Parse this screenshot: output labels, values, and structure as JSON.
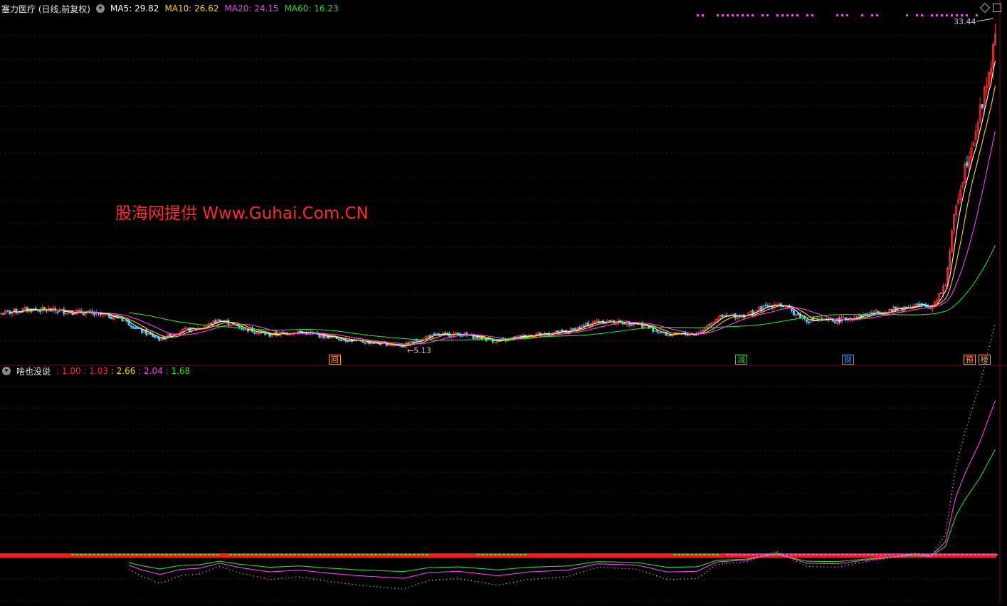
{
  "main_panel": {
    "title": "塞力医疗 (日线,前复权)",
    "ma": [
      {
        "label": "MA5:",
        "value": "29.82",
        "color": "#ffffff"
      },
      {
        "label": "MA10:",
        "value": "26.62",
        "color": "#ffd400"
      },
      {
        "label": "MA20:",
        "value": "24.15",
        "color": "#ff3cff"
      },
      {
        "label": "MA60:",
        "value": "16.23",
        "color": "#22e022"
      }
    ],
    "watermark": "股海网提供 Www.Guhai.Com.CN",
    "peak_label": "33.44",
    "low_label": "5.13",
    "markers": [
      {
        "text": "回",
        "color": "#ff9f40",
        "pos": 0.33
      },
      {
        "text": "减",
        "color": "#22dd22",
        "pos": 0.738
      },
      {
        "text": "财",
        "color": "#3aa0ff",
        "pos": 0.845
      },
      {
        "text": "预",
        "color": "#ff9f40",
        "pos": 0.967
      },
      {
        "text": "榜",
        "color": "#ff9f40",
        "pos": 0.982
      }
    ]
  },
  "sub_panel": {
    "title": "啥也没说",
    "values": [
      {
        "text": "1.00",
        "color": "#ff2a2a"
      },
      {
        "text": "1.03",
        "color": "#ff2a2a"
      },
      {
        "text": "2.66",
        "color": "#ffd400"
      },
      {
        "text": "2.04",
        "color": "#ff3cff"
      },
      {
        "text": "1.68",
        "color": "#22e022"
      }
    ]
  },
  "chart_data": {
    "type": "line",
    "title": "塞力医疗 (日线,前复权)",
    "price_range": [
      4.5,
      36
    ],
    "series": [
      {
        "name": "MA5",
        "color": "#ffffff",
        "last": 29.82
      },
      {
        "name": "MA10",
        "color": "#ffd400",
        "last": 26.62
      },
      {
        "name": "MA20",
        "color": "#ff3cff",
        "last": 24.15
      },
      {
        "name": "MA60",
        "color": "#22e022",
        "last": 16.23
      }
    ],
    "close_keypoints": [
      [
        0,
        8.2
      ],
      [
        0.03,
        8.6
      ],
      [
        0.08,
        8.3
      ],
      [
        0.12,
        7.8
      ],
      [
        0.14,
        6.6
      ],
      [
        0.16,
        5.8
      ],
      [
        0.18,
        6.6
      ],
      [
        0.2,
        6.8
      ],
      [
        0.22,
        7.6
      ],
      [
        0.24,
        6.9
      ],
      [
        0.27,
        6.2
      ],
      [
        0.3,
        6.5
      ],
      [
        0.33,
        6.0
      ],
      [
        0.36,
        5.6
      ],
      [
        0.405,
        5.2
      ],
      [
        0.43,
        6.1
      ],
      [
        0.46,
        6.3
      ],
      [
        0.5,
        5.6
      ],
      [
        0.53,
        6.2
      ],
      [
        0.57,
        6.5
      ],
      [
        0.6,
        7.5
      ],
      [
        0.64,
        7.3
      ],
      [
        0.67,
        6.2
      ],
      [
        0.7,
        6.3
      ],
      [
        0.72,
        7.8
      ],
      [
        0.75,
        8.1
      ],
      [
        0.78,
        9.2
      ],
      [
        0.81,
        7.6
      ],
      [
        0.84,
        7.5
      ],
      [
        0.87,
        8.1
      ],
      [
        0.9,
        8.6
      ],
      [
        0.92,
        9.0
      ],
      [
        0.935,
        8.7
      ],
      [
        0.95,
        11.0
      ],
      [
        0.96,
        18.0
      ],
      [
        0.97,
        22.0
      ],
      [
        0.985,
        27.0
      ],
      [
        1.0,
        33.44
      ]
    ],
    "price_high": 33.44,
    "price_low": 5.13
  }
}
